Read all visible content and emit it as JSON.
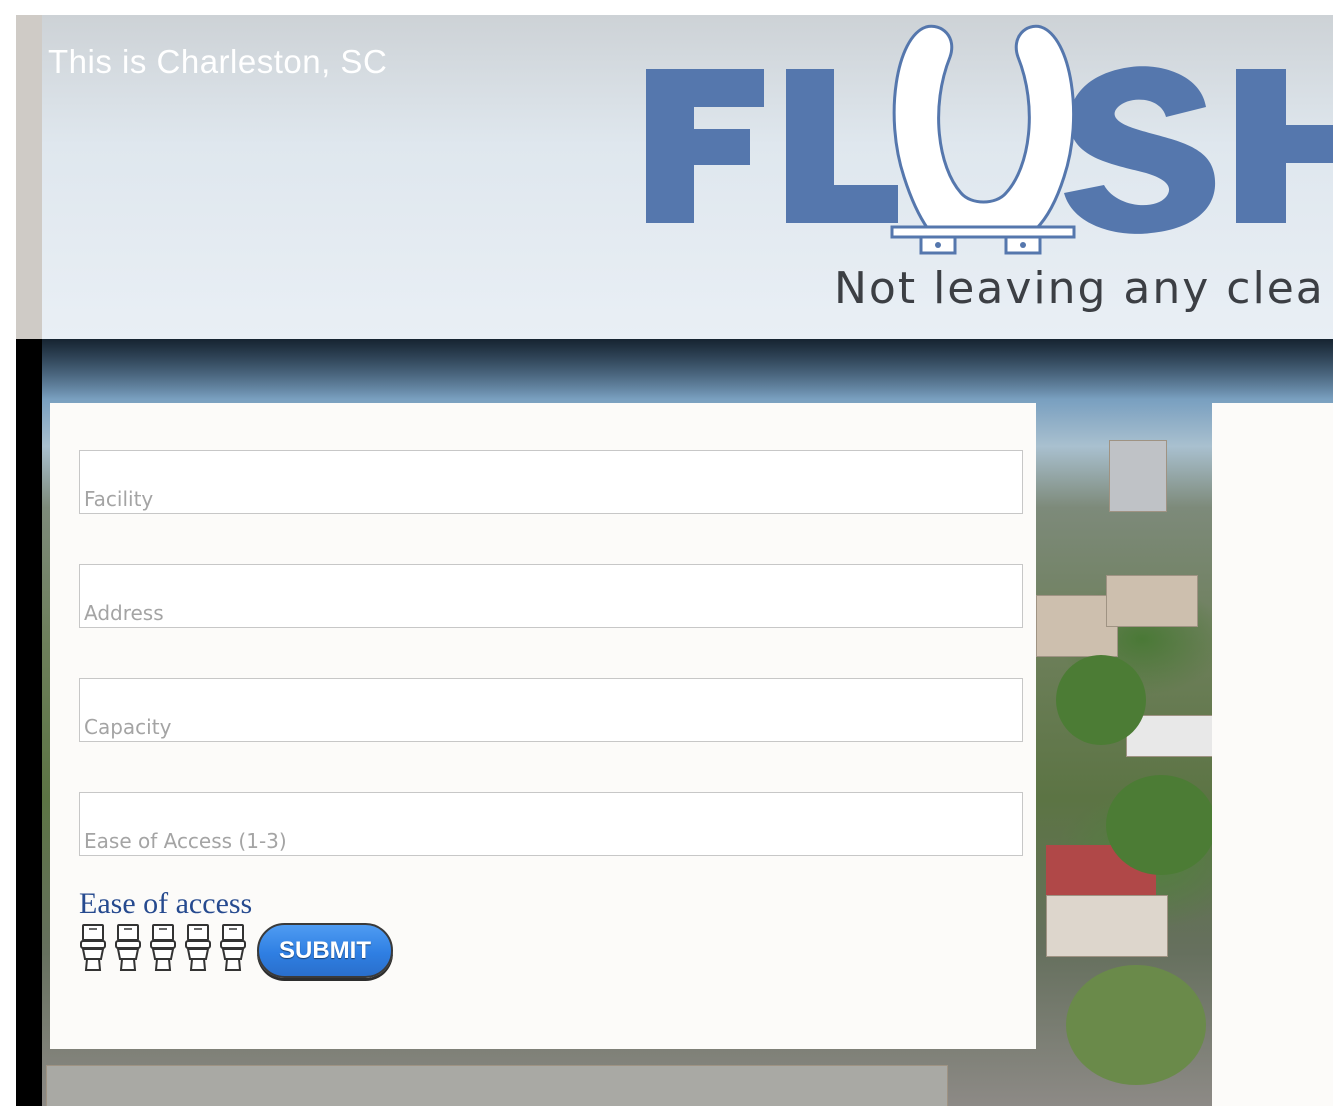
{
  "header": {
    "location": "This is Charleston, SC",
    "logo_text": "FLUSH",
    "tagline": "Not leaving any clea"
  },
  "form": {
    "fields": [
      {
        "placeholder": "Facility",
        "value": ""
      },
      {
        "placeholder": "Address",
        "value": ""
      },
      {
        "placeholder": "Capacity",
        "value": ""
      },
      {
        "placeholder": "Ease of Access (1-3)",
        "value": ""
      }
    ],
    "ease_label": "Ease of access",
    "rating": {
      "max": 5,
      "icon": "toilet-icon"
    },
    "submit_label": "SUBMIT"
  },
  "colors": {
    "logo_blue": "#5577ad",
    "submit_blue": "#3286e8",
    "label_blue": "#264a8f"
  }
}
